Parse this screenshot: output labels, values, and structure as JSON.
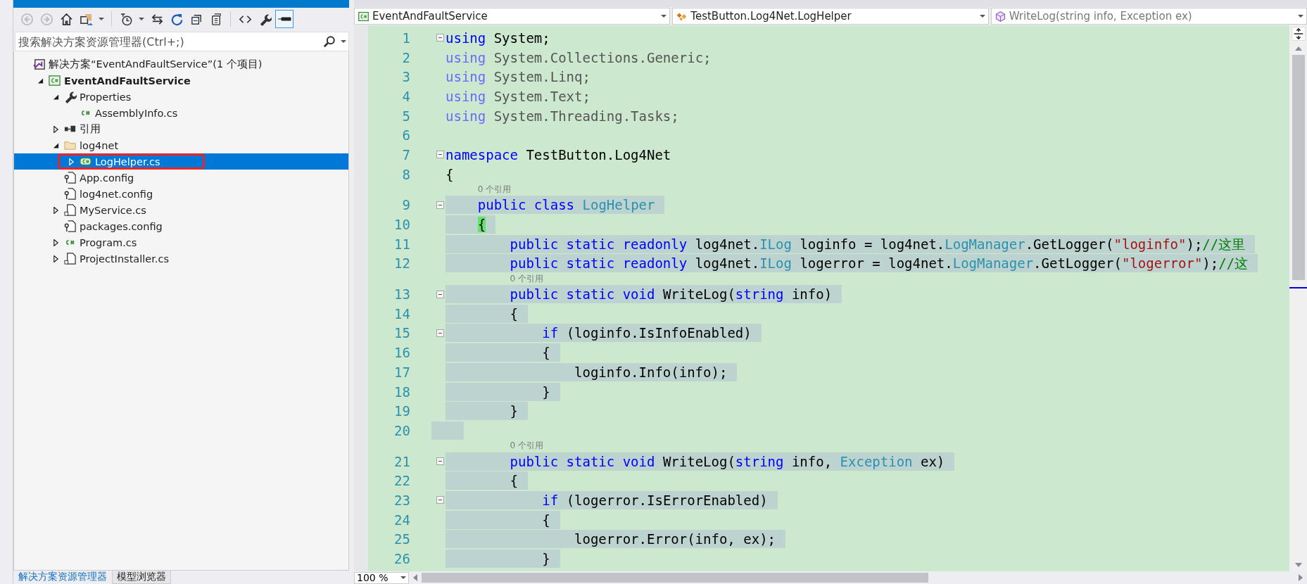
{
  "toolbar": [
    {
      "kind": "back",
      "disabled": true,
      "selected": false
    },
    {
      "kind": "forward",
      "disabled": true,
      "selected": false
    },
    {
      "kind": "home",
      "disabled": false,
      "selected": false
    },
    {
      "kind": "views",
      "disabled": false,
      "selected": false,
      "dropdown": true
    },
    {
      "kind": "separator"
    },
    {
      "kind": "history",
      "disabled": false,
      "selected": false,
      "dropdown": true
    },
    {
      "kind": "sync",
      "disabled": false,
      "selected": false
    },
    {
      "kind": "refresh",
      "disabled": false,
      "selected": false
    },
    {
      "kind": "collapse",
      "disabled": false,
      "selected": false
    },
    {
      "kind": "copy",
      "disabled": false,
      "selected": false
    },
    {
      "kind": "separator"
    },
    {
      "kind": "code",
      "disabled": false,
      "selected": false
    },
    {
      "kind": "properties",
      "disabled": false,
      "selected": false
    },
    {
      "kind": "preview",
      "disabled": false,
      "selected": true
    }
  ],
  "search": {
    "placeholder": "搜索解决方案资源管理器(Ctrl+;)"
  },
  "tree": [
    {
      "kind": "solution",
      "label": "解决方案“EventAndFaultService”(1 个项目)",
      "selected": false,
      "children": [
        {
          "kind": "project",
          "label": "EventAndFaultService",
          "expanded": true,
          "selected": false,
          "children": [
            {
              "kind": "properties",
              "label": "Properties",
              "expanded": true,
              "selected": false,
              "children": [
                {
                  "kind": "source",
                  "label": "AssemblyInfo.cs",
                  "selected": false
                }
              ]
            },
            {
              "kind": "references",
              "label": "引用",
              "expanded": false,
              "selected": false
            },
            {
              "kind": "folder",
              "label": "log4net",
              "expanded": true,
              "selected": false,
              "children": [
                {
                  "kind": "class",
                  "label": "LogHelper.cs",
                  "expanded": false,
                  "selected": true,
                  "marked": true
                }
              ]
            },
            {
              "kind": "config",
              "label": "App.config",
              "selected": false
            },
            {
              "kind": "config",
              "label": "log4net.config",
              "selected": false
            },
            {
              "kind": "file",
              "label": "MyService.cs",
              "expanded": false,
              "selected": false
            },
            {
              "kind": "config",
              "label": "packages.config",
              "selected": false
            },
            {
              "kind": "source",
              "label": "Program.cs",
              "expanded": false,
              "selected": false
            },
            {
              "kind": "file",
              "label": "ProjectInstaller.cs",
              "expanded": false,
              "selected": false
            }
          ]
        }
      ]
    }
  ],
  "bottom_tabs": [
    {
      "label": "解决方案资源管理器",
      "selected": true
    },
    {
      "label": "模型浏览器",
      "selected": false
    }
  ],
  "navigation": [
    {
      "kind": "project",
      "text": "EventAndFaultService"
    },
    {
      "kind": "class",
      "text": "TestButton.Log4Net.LogHelper"
    },
    {
      "kind": "member",
      "text": "WriteLog(string info, Exception ex)"
    }
  ],
  "code": [
    {
      "kind": "line",
      "number": "1",
      "foldable": true,
      "highlighted": false,
      "tokens": [
        {
          "kind": "kw",
          "text": "using"
        },
        {
          "kind": "plain",
          "text": " System;"
        }
      ]
    },
    {
      "kind": "line",
      "number": "2",
      "foldable": false,
      "highlighted": false,
      "tokens": [
        {
          "kind": "dimkw",
          "text": "using"
        },
        {
          "kind": "dim",
          "text": " System.Collections.Generic;"
        }
      ]
    },
    {
      "kind": "line",
      "number": "3",
      "foldable": false,
      "highlighted": false,
      "tokens": [
        {
          "kind": "dimkw",
          "text": "using"
        },
        {
          "kind": "dim",
          "text": " System.Linq;"
        }
      ]
    },
    {
      "kind": "line",
      "number": "4",
      "foldable": false,
      "highlighted": false,
      "tokens": [
        {
          "kind": "dimkw",
          "text": "using"
        },
        {
          "kind": "dim",
          "text": " System.Text;"
        }
      ]
    },
    {
      "kind": "line",
      "number": "5",
      "foldable": false,
      "highlighted": false,
      "tokens": [
        {
          "kind": "dimkw",
          "text": "using"
        },
        {
          "kind": "dim",
          "text": " System.Threading.Tasks;"
        }
      ]
    },
    {
      "kind": "line",
      "number": "6",
      "foldable": false,
      "highlighted": false
    },
    {
      "kind": "line",
      "number": "7",
      "foldable": true,
      "highlighted": false,
      "tokens": [
        {
          "kind": "kw",
          "text": "namespace"
        },
        {
          "kind": "plain",
          "text": " TestButton.Log4Net"
        }
      ]
    },
    {
      "kind": "line",
      "number": "8",
      "foldable": false,
      "highlighted": false,
      "tokens": [
        {
          "kind": "plain",
          "text": "{"
        }
      ]
    },
    {
      "kind": "lens",
      "text": "0 个引用"
    },
    {
      "kind": "line",
      "number": "9",
      "foldable": true,
      "highlighted": true,
      "tokens": [
        {
          "kind": "kw",
          "text": "    public class"
        },
        {
          "kind": "type",
          "text": " LogHelper"
        }
      ]
    },
    {
      "kind": "line",
      "number": "10",
      "foldable": false,
      "highlighted": true,
      "tokens": [
        {
          "kind": "match",
          "text": "    {"
        }
      ]
    },
    {
      "kind": "line",
      "number": "11",
      "foldable": false,
      "highlighted": true,
      "tokens": [
        {
          "kind": "kw",
          "text": "        public static readonly"
        },
        {
          "kind": "plain",
          "text": " log4net."
        },
        {
          "kind": "type",
          "text": "ILog"
        },
        {
          "kind": "plain",
          "text": " loginfo = log4net."
        },
        {
          "kind": "type",
          "text": "LogManager"
        },
        {
          "kind": "plain",
          "text": ".GetLogger("
        },
        {
          "kind": "str",
          "text": "\"loginfo\""
        },
        {
          "kind": "plain",
          "text": ");"
        },
        {
          "kind": "comment",
          "text": "//这里"
        }
      ]
    },
    {
      "kind": "line",
      "number": "12",
      "foldable": false,
      "highlighted": true,
      "tokens": [
        {
          "kind": "kw",
          "text": "        public static readonly"
        },
        {
          "kind": "plain",
          "text": " log4net."
        },
        {
          "kind": "type",
          "text": "ILog"
        },
        {
          "kind": "plain",
          "text": " logerror = log4net."
        },
        {
          "kind": "type",
          "text": "LogManager"
        },
        {
          "kind": "plain",
          "text": ".GetLogger("
        },
        {
          "kind": "str",
          "text": "\"logerror\""
        },
        {
          "kind": "plain",
          "text": ");"
        },
        {
          "kind": "comment",
          "text": "//这"
        }
      ]
    },
    {
      "kind": "lens",
      "text": "0 个引用"
    },
    {
      "kind": "line",
      "number": "13",
      "foldable": true,
      "highlighted": true,
      "tokens": [
        {
          "kind": "kw",
          "text": "        public static void"
        },
        {
          "kind": "plain",
          "text": " WriteLog("
        },
        {
          "kind": "kw",
          "text": "string"
        },
        {
          "kind": "plain",
          "text": " info)"
        }
      ]
    },
    {
      "kind": "line",
      "number": "14",
      "foldable": false,
      "highlighted": true,
      "tokens": [
        {
          "kind": "plain",
          "text": "        {"
        }
      ]
    },
    {
      "kind": "line",
      "number": "15",
      "foldable": true,
      "highlighted": true,
      "tokens": [
        {
          "kind": "kw",
          "text": "            if"
        },
        {
          "kind": "plain",
          "text": " (loginfo.IsInfoEnabled)"
        }
      ]
    },
    {
      "kind": "line",
      "number": "16",
      "foldable": false,
      "highlighted": true,
      "tokens": [
        {
          "kind": "plain",
          "text": "            {"
        }
      ]
    },
    {
      "kind": "line",
      "number": "17",
      "foldable": false,
      "highlighted": true,
      "tokens": [
        {
          "kind": "plain",
          "text": "                loginfo.Info(info);"
        }
      ]
    },
    {
      "kind": "line",
      "number": "18",
      "foldable": false,
      "highlighted": true,
      "tokens": [
        {
          "kind": "plain",
          "text": "            }"
        }
      ]
    },
    {
      "kind": "line",
      "number": "19",
      "foldable": false,
      "highlighted": true,
      "tokens": [
        {
          "kind": "plain",
          "text": "        }"
        }
      ]
    },
    {
      "kind": "line",
      "number": "20",
      "foldable": false,
      "highlighted": true
    },
    {
      "kind": "lens",
      "text": "0 个引用"
    },
    {
      "kind": "line",
      "number": "21",
      "foldable": true,
      "highlighted": true,
      "tokens": [
        {
          "kind": "kw",
          "text": "        public static void"
        },
        {
          "kind": "plain",
          "text": " WriteLog("
        },
        {
          "kind": "kw",
          "text": "string"
        },
        {
          "kind": "plain",
          "text": " info, "
        },
        {
          "kind": "type",
          "text": "Exception"
        },
        {
          "kind": "plain",
          "text": " ex)"
        }
      ]
    },
    {
      "kind": "line",
      "number": "22",
      "foldable": false,
      "highlighted": true,
      "tokens": [
        {
          "kind": "plain",
          "text": "        {"
        }
      ]
    },
    {
      "kind": "line",
      "number": "23",
      "foldable": true,
      "highlighted": true,
      "tokens": [
        {
          "kind": "kw",
          "text": "            if"
        },
        {
          "kind": "plain",
          "text": " (logerror.IsErrorEnabled)"
        }
      ]
    },
    {
      "kind": "line",
      "number": "24",
      "foldable": false,
      "highlighted": true,
      "tokens": [
        {
          "kind": "plain",
          "text": "            {"
        }
      ]
    },
    {
      "kind": "line",
      "number": "25",
      "foldable": false,
      "highlighted": true,
      "tokens": [
        {
          "kind": "plain",
          "text": "                logerror.Error(info, ex);"
        }
      ]
    },
    {
      "kind": "line",
      "number": "26",
      "foldable": false,
      "highlighted": true,
      "tokens": [
        {
          "kind": "plain",
          "text": "            }"
        }
      ]
    }
  ],
  "zoom": {
    "value": "100 %"
  }
}
